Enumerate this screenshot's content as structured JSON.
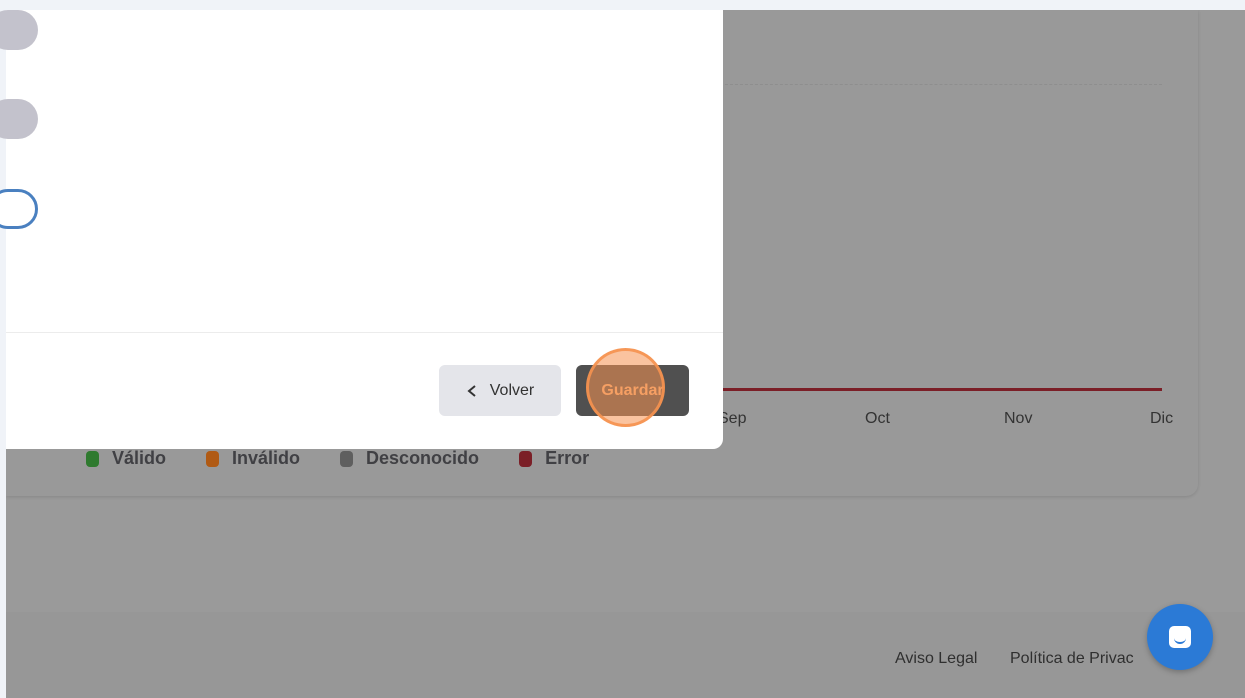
{
  "chart": {
    "months": [
      "Sep",
      "Oct",
      "Nov",
      "Dic"
    ],
    "legend": [
      {
        "label": "Válido",
        "color": "#2f7a2f"
      },
      {
        "label": "Inválido",
        "color": "#b05a14"
      },
      {
        "label": "Desconocido",
        "color": "#5f5f5f"
      },
      {
        "label": "Error",
        "color": "#7b1f27"
      }
    ]
  },
  "modal": {
    "toggles": [
      {
        "name": "toggle-1",
        "state": "off"
      },
      {
        "name": "toggle-2",
        "state": "off"
      },
      {
        "name": "toggle-3",
        "state": "on"
      }
    ],
    "back_label": "Volver",
    "back_icon": "chevron-left-icon",
    "save_label": "Guardar"
  },
  "footer": {
    "legal_label": "Aviso Legal",
    "privacy_label": "Política de Privac"
  },
  "chat": {
    "icon": "chat-icon"
  },
  "colors": {
    "accent": "#2b7ad6",
    "save_text": "#f5b07a",
    "click_highlight": "#f69250"
  }
}
